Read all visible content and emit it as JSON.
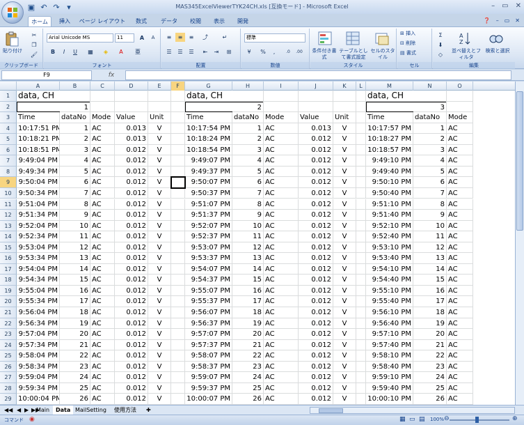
{
  "window": {
    "title": "MAS345ExcelViewerTYK24CH.xls  [互換モード] - Microsoft Excel"
  },
  "tabs": [
    "ホーム",
    "挿入",
    "ページ レイアウト",
    "数式",
    "データ",
    "校閲",
    "表示",
    "開発"
  ],
  "ribbon": {
    "clipboard": {
      "paste": "貼り付け",
      "label": "クリップボード"
    },
    "font": {
      "name": "Arial Unicode MS",
      "size": "11",
      "label": "フォント",
      "bold": "B",
      "italic": "I",
      "underline": "U",
      "grow": "A",
      "shrink": "A"
    },
    "alignment": {
      "label": "配置"
    },
    "number": {
      "format": "標準",
      "label": "数値"
    },
    "styles": {
      "label": "スタイル",
      "conditional": "条件付き書式",
      "table": "テーブルとして書式設定",
      "cell": "セルのスタイル"
    },
    "cells": {
      "label": "セル",
      "insert": "挿入",
      "delete": "削除",
      "format": "書式"
    },
    "editing": {
      "label": "編集",
      "sort": "並べ替えとフィルタ",
      "find": "検索と選択"
    }
  },
  "formula_bar": {
    "namebox": "F9",
    "fx": "fx",
    "value": ""
  },
  "columns": [
    "A",
    "B",
    "C",
    "D",
    "E",
    "F",
    "G",
    "H",
    "I",
    "J",
    "K",
    "L",
    "M",
    "N",
    "O"
  ],
  "selected_column": "F",
  "selected_row": "9",
  "row_numbers": [
    "1",
    "2",
    "3",
    "4",
    "5",
    "6",
    "7",
    "8",
    "9",
    "10",
    "11",
    "12",
    "13",
    "14",
    "15",
    "16",
    "17",
    "18",
    "19",
    "20",
    "21",
    "22",
    "23",
    "24",
    "25",
    "26",
    "27",
    "28",
    "29"
  ],
  "header_text": {
    "label": "data, CH",
    "time": "Time",
    "dataNo": "dataNo",
    "mode": "Mode",
    "value": "Value",
    "unit": "Unit"
  },
  "blocks": [
    {
      "ch": "1",
      "times": [
        "10:17:51 PM",
        "10:18:21 PM",
        "10:18:51 PM",
        "9:49:04 PM",
        "9:49:34 PM",
        "9:50:04 PM",
        "9:50:34 PM",
        "9:51:04 PM",
        "9:51:34 PM",
        "9:52:04 PM",
        "9:52:34 PM",
        "9:53:04 PM",
        "9:53:34 PM",
        "9:54:04 PM",
        "9:54:34 PM",
        "9:55:04 PM",
        "9:55:34 PM",
        "9:56:04 PM",
        "9:56:34 PM",
        "9:57:04 PM",
        "9:57:34 PM",
        "9:58:04 PM",
        "9:58:34 PM",
        "9:59:04 PM",
        "9:59:34 PM",
        "10:00:04 PM"
      ],
      "values": [
        "0.013",
        "0.013",
        "0.012",
        "0.012",
        "0.012",
        "0.012",
        "0.012",
        "0.012",
        "0.012",
        "0.012",
        "0.012",
        "0.012",
        "0.012",
        "0.012",
        "0.012",
        "0.012",
        "0.012",
        "0.012",
        "0.012",
        "0.012",
        "0.012",
        "0.012",
        "0.012",
        "0.012",
        "0.012",
        "0.012"
      ]
    },
    {
      "ch": "2",
      "times": [
        "10:17:54 PM",
        "10:18:24 PM",
        "10:18:54 PM",
        "9:49:07 PM",
        "9:49:37 PM",
        "9:50:07 PM",
        "9:50:37 PM",
        "9:51:07 PM",
        "9:51:37 PM",
        "9:52:07 PM",
        "9:52:37 PM",
        "9:53:07 PM",
        "9:53:37 PM",
        "9:54:07 PM",
        "9:54:37 PM",
        "9:55:07 PM",
        "9:55:37 PM",
        "9:56:07 PM",
        "9:56:37 PM",
        "9:57:07 PM",
        "9:57:37 PM",
        "9:58:07 PM",
        "9:58:37 PM",
        "9:59:07 PM",
        "9:59:37 PM",
        "10:00:07 PM"
      ],
      "values": [
        "0.013",
        "0.012",
        "0.012",
        "0.012",
        "0.012",
        "0.012",
        "0.012",
        "0.012",
        "0.012",
        "0.012",
        "0.012",
        "0.012",
        "0.012",
        "0.012",
        "0.012",
        "0.012",
        "0.012",
        "0.012",
        "0.012",
        "0.012",
        "0.012",
        "0.012",
        "0.012",
        "0.012",
        "0.012",
        "0.012"
      ]
    },
    {
      "ch": "3",
      "times": [
        "10:17:57 PM",
        "10:18:27 PM",
        "10:18:57 PM",
        "9:49:10 PM",
        "9:49:40 PM",
        "9:50:10 PM",
        "9:50:40 PM",
        "9:51:10 PM",
        "9:51:40 PM",
        "9:52:10 PM",
        "9:52:40 PM",
        "9:53:10 PM",
        "9:53:40 PM",
        "9:54:10 PM",
        "9:54:40 PM",
        "9:55:10 PM",
        "9:55:40 PM",
        "9:56:10 PM",
        "9:56:40 PM",
        "9:57:10 PM",
        "9:57:40 PM",
        "9:58:10 PM",
        "9:58:40 PM",
        "9:59:10 PM",
        "9:59:40 PM",
        "10:00:10 PM"
      ],
      "values": []
    }
  ],
  "mode_value": "AC",
  "unit_value": "V",
  "sheet_tabs": [
    "Main",
    "Data",
    "MailSetting",
    "使用方法"
  ],
  "active_sheet": "Data",
  "status": {
    "text": "コマンド",
    "zoom": "100%"
  }
}
